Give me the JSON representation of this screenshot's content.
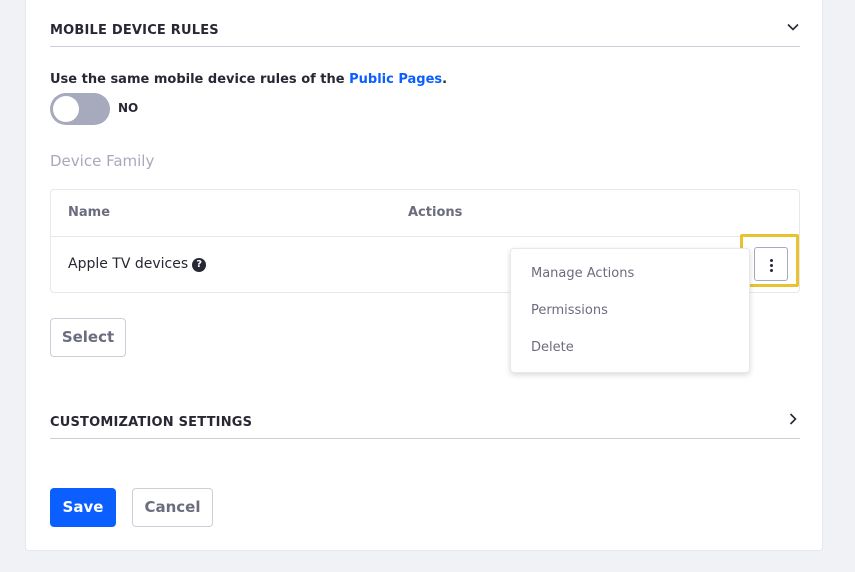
{
  "mobile_section": {
    "title": "MOBILE DEVICE RULES",
    "caret_icon": "chevron-down-icon"
  },
  "same_rules": {
    "prefix": "Use the same mobile device rules of the ",
    "link": "Public Pages",
    "suffix": "."
  },
  "toggle": {
    "state": false,
    "label": "NO"
  },
  "device_family": {
    "label": "Device Family",
    "columns": [
      "Name",
      "Actions"
    ],
    "rows": [
      {
        "name": "Apple TV devices",
        "help_icon": "?"
      }
    ]
  },
  "actions_menu": {
    "trigger_icon": "kebab-vertical-icon",
    "items": [
      "Manage Actions",
      "Permissions",
      "Delete"
    ],
    "highlight_color": "#e8c22f"
  },
  "select_button": "Select",
  "customization_section": {
    "title": "CUSTOMIZATION SETTINGS",
    "caret_icon": "chevron-right-icon"
  },
  "footer": {
    "save": "Save",
    "cancel": "Cancel"
  },
  "colors": {
    "accent": "#0b5fff",
    "highlight": "#e8c22f"
  }
}
